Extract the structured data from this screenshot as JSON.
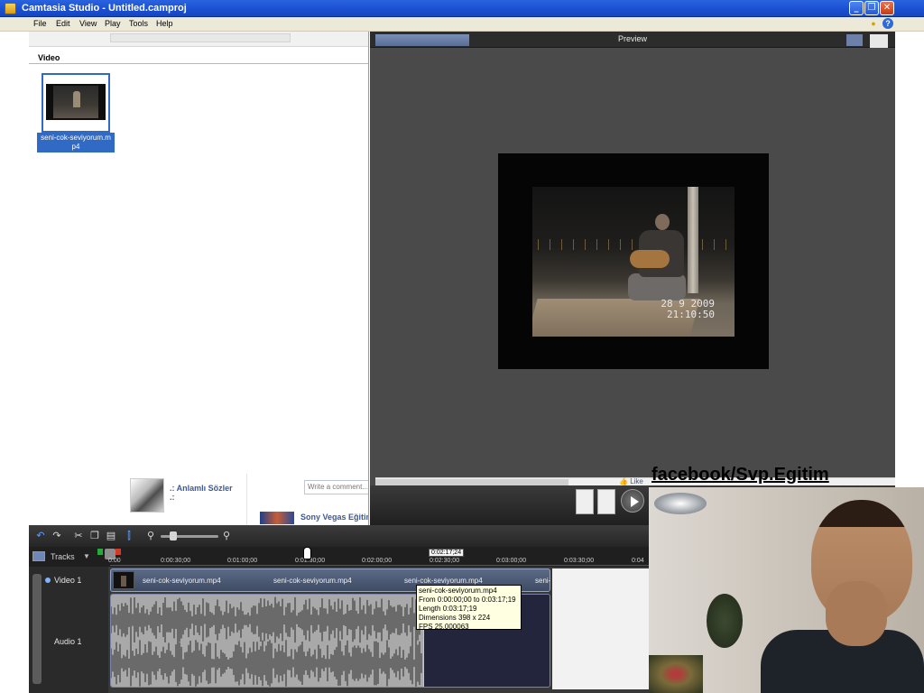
{
  "window": {
    "title": "Camtasia Studio - Untitled.camproj",
    "buttons": {
      "minimize": "_",
      "restore": "❐",
      "close": "✕"
    }
  },
  "menu": {
    "items": [
      "File",
      "Edit",
      "View",
      "Play",
      "Tools",
      "Help"
    ]
  },
  "clip_bin": {
    "section_label": "Video",
    "clip_name": "seni-cok-seviyorum.mp4"
  },
  "facebook_page": {
    "poster_name_line1": ".: Anlamlı Sözler",
    "poster_name_line2": ".:",
    "comment_placeholder": "Write a comment...",
    "page_name": "Sony Vegas Eğitim",
    "like_text": "Like"
  },
  "preview": {
    "title": "Preview",
    "timestamp_date": "28  9 2009",
    "timestamp_time": "21:10:50"
  },
  "watermark": "facebook/Svp.Egitim",
  "timeline": {
    "tracks_label": "Tracks",
    "playhead_time": "0:02:17;24",
    "ruler_labels": [
      "0:00",
      "0:00:30;00",
      "0:01:00;00",
      "0:01:30;00",
      "0:02:00;00",
      "0:02:30;00",
      "0:03:00;00",
      "0:03:30;00",
      "0:04"
    ],
    "tracks": [
      {
        "name": "Video 1"
      },
      {
        "name": "Audio 1"
      }
    ],
    "video_clip_labels": [
      "seni-cok-seviyorum.mp4",
      "seni-cok-seviyorum.mp4",
      "seni-cok-seviyorum.mp4",
      "seni-"
    ]
  },
  "tooltip": {
    "lines": [
      "seni-cok-seviyorum.mp4",
      "From 0:00:00;00 to 0:03:17;19",
      "Length 0:03:17;19",
      "Dimensions 398 x 224",
      "FPS 25,000063"
    ]
  },
  "colors": {
    "titlebar": "#1a4fd0",
    "selection": "#316ac5",
    "facebook_link": "#3b5998",
    "tooltip_bg": "#ffffe1"
  }
}
